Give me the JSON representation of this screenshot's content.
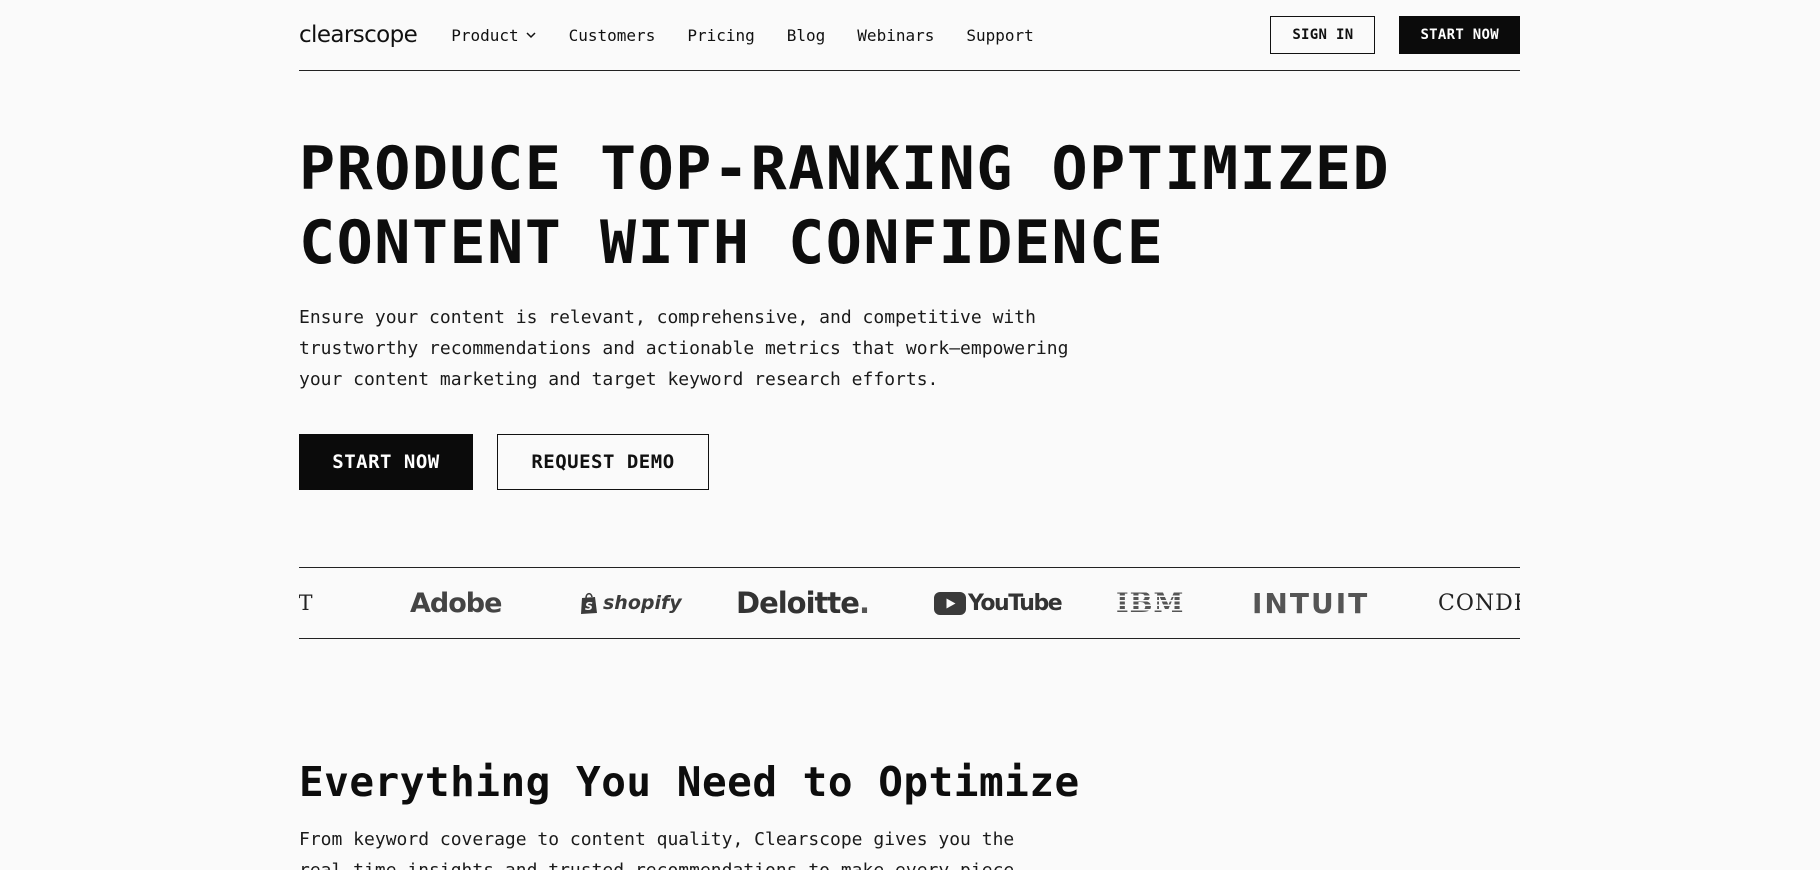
{
  "nav": {
    "logo": "clearscope",
    "links": [
      {
        "label": "Product",
        "has_dropdown": true
      },
      {
        "label": "Customers"
      },
      {
        "label": "Pricing"
      },
      {
        "label": "Blog"
      },
      {
        "label": "Webinars"
      },
      {
        "label": "Support"
      }
    ],
    "sign_in": "SIGN IN",
    "start_now": "START NOW"
  },
  "hero": {
    "title_lines": [
      "PRODUCE TOP-RANKING OPTIMIZED",
      "CONTENT WITH CONFIDENCE"
    ],
    "description_lines": [
      "Ensure your content is relevant, comprehensive, and competitive with",
      "trustworthy recommendations and actionable metrics that work—empowering",
      "your content marketing and target keyword research efforts."
    ],
    "cta_primary": "START NOW",
    "cta_secondary": "REQUEST DEMO"
  },
  "logos": {
    "partial_left": "AST",
    "items": [
      "Adobe",
      "shopify",
      "Deloitte",
      "YouTube",
      "IBM",
      "INTUIT",
      "CONDÉ"
    ],
    "deloitte_dot": "."
  },
  "features": {
    "title": "Everything You Need to Optimize",
    "description_lines": [
      "From keyword coverage to content quality, Clearscope gives you the",
      "real-time insights and trusted recommendations to make every piece"
    ]
  },
  "colors": {
    "background": "#fafafa",
    "text": "#111111",
    "button_dark": "#0b0b0b",
    "logo_gray": "#444444"
  }
}
